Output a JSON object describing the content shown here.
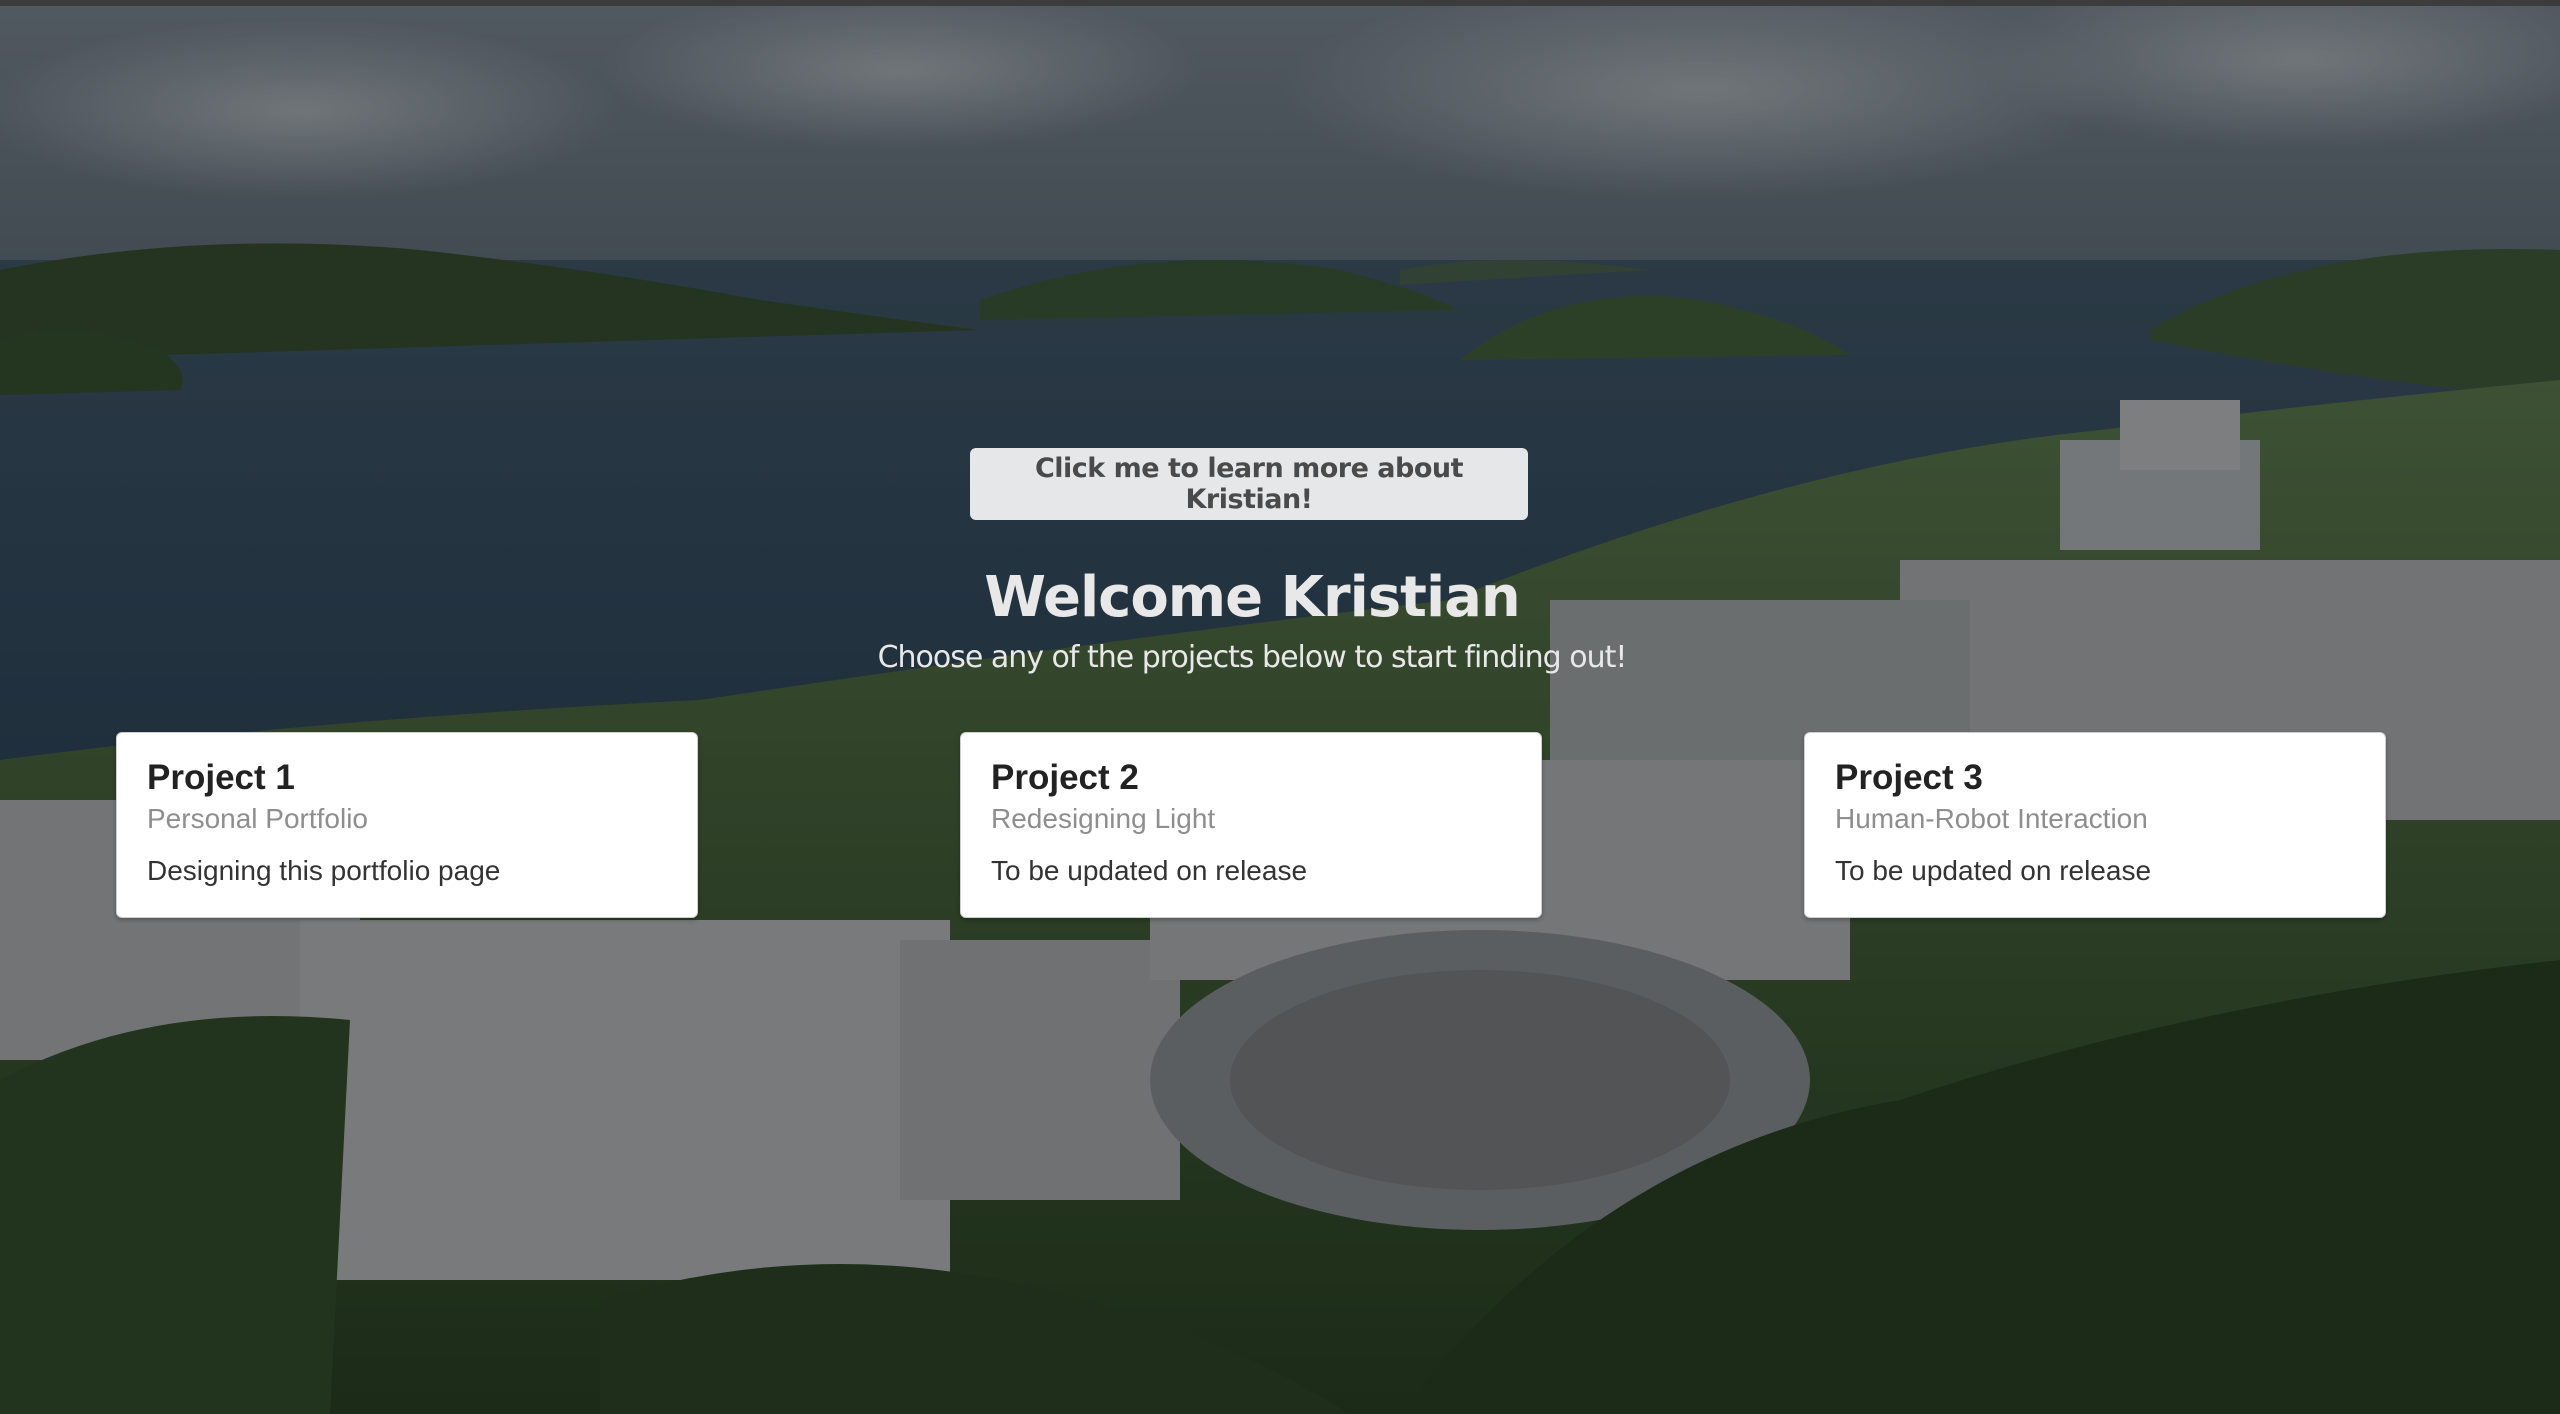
{
  "hero": {
    "button_label": "Click me to learn more about Kristian!",
    "title": "Welcome Kristian",
    "subtitle": "Choose any of the projects below to start finding out!"
  },
  "projects": [
    {
      "title": "Project 1",
      "subtitle": "Personal Portfolio",
      "text": "Designing this portfolio page"
    },
    {
      "title": "Project 2",
      "subtitle": "Redesigning Light",
      "text": "To be updated on release"
    },
    {
      "title": "Project 3",
      "subtitle": "Human-Robot Interaction",
      "text": "To be updated on release"
    }
  ],
  "colors": {
    "card_background": "#ffffff",
    "button_background": "#e6e7e9",
    "heading_text": "#e8e8e8",
    "overlay": "rgba(0,0,0,0.42)"
  }
}
